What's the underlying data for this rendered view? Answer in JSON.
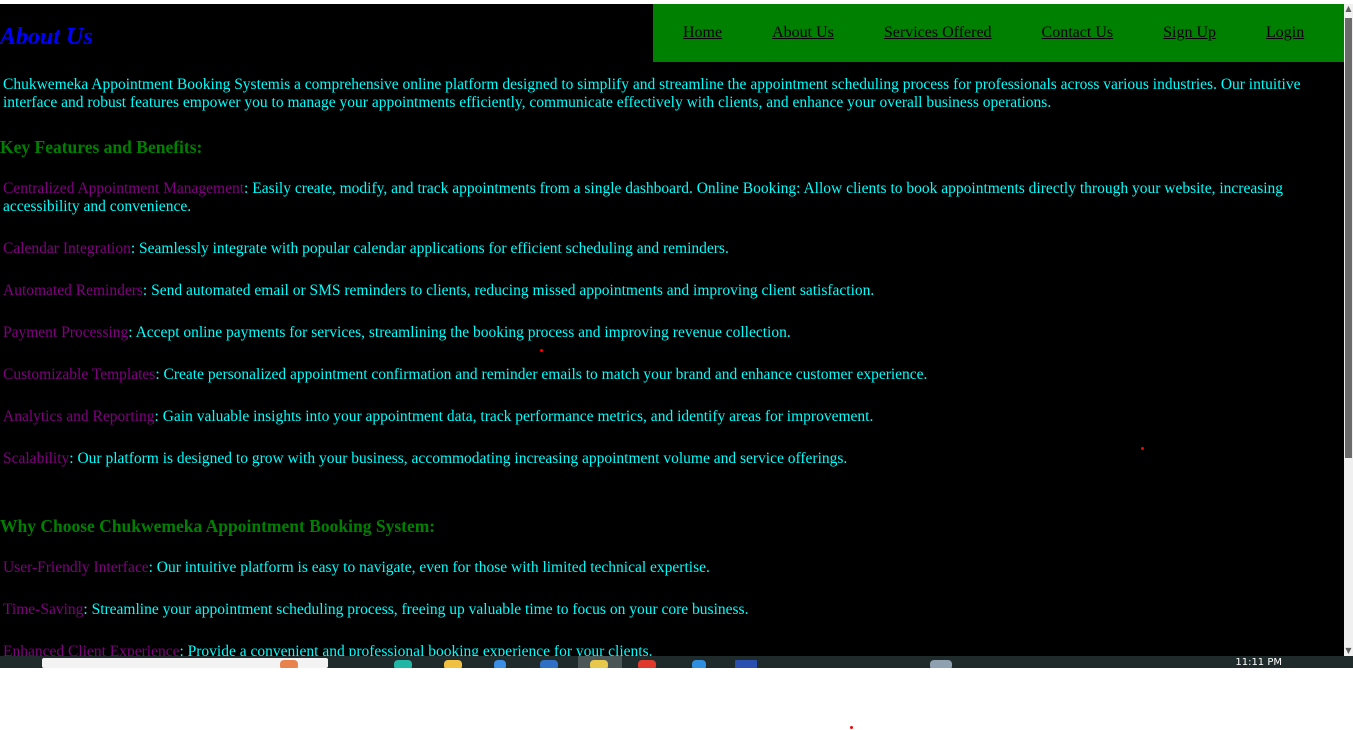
{
  "header": {
    "title": "About Us"
  },
  "nav": {
    "items": [
      "Home",
      "About Us",
      "Services Offered",
      "Contact Us",
      "Sign Up",
      "Login"
    ]
  },
  "intro": "Chukwemeka Appointment Booking Systemis a comprehensive online platform designed to simplify and streamline the appointment scheduling process for professionals across various industries. Our intuitive interface and robust features empower you to manage your appointments efficiently, communicate effectively with clients, and enhance your overall business operations.",
  "features": {
    "heading": "Key Features and Benefits:",
    "items": [
      {
        "term": "Centralized Appointment Management",
        "text": ": Easily create, modify, and track appointments from a single dashboard. Online Booking: Allow clients to book appointments directly through your website, increasing accessibility and convenience."
      },
      {
        "term": "Calendar Integration",
        "text": ": Seamlessly integrate with popular calendar applications for efficient scheduling and reminders."
      },
      {
        "term": "Automated Reminders",
        "text": ": Send automated email or SMS reminders to clients, reducing missed appointments and improving client satisfaction."
      },
      {
        "term": "Payment Processing",
        "text": ": Accept online payments for services, streamlining the booking process and improving revenue collection."
      },
      {
        "term": "Customizable Templates",
        "text": ": Create personalized appointment confirmation and reminder emails to match your brand and enhance customer experience."
      },
      {
        "term": "Analytics and Reporting",
        "text": ": Gain valuable insights into your appointment data, track performance metrics, and identify areas for improvement."
      },
      {
        "term": "Scalability",
        "text": ": Our platform is designed to grow with your business, accommodating increasing appointment volume and service offerings."
      }
    ]
  },
  "why": {
    "heading": "Why Choose Chukwemeka Appointment Booking System:",
    "items": [
      {
        "term": "User-Friendly Interface",
        "text": ": Our intuitive platform is easy to navigate, even for those with limited technical expertise."
      },
      {
        "term": "Time-Saving",
        "text": ": Streamline your appointment scheduling process, freeing up valuable time to focus on your core business."
      },
      {
        "term": "Enhanced Client Experience",
        "text": ": Provide a convenient and professional booking experience for your clients."
      }
    ]
  },
  "taskbar": {
    "clock": "11:11 PM"
  },
  "colors": {
    "background": "#000000",
    "nav": "#008000",
    "title": "#0000ff",
    "heading": "#008000",
    "body_text": "#00ffff",
    "term": "#800080"
  }
}
